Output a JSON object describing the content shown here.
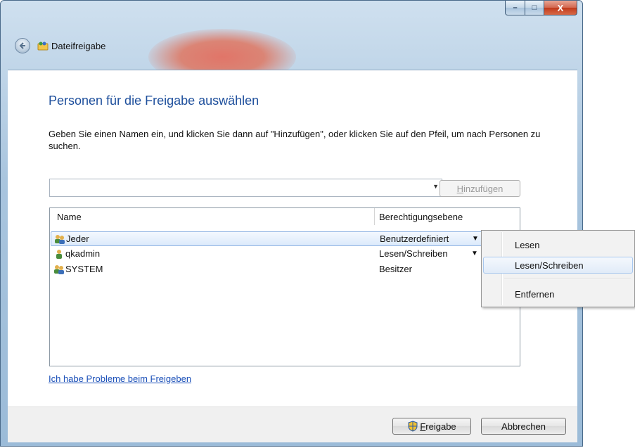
{
  "window": {
    "title": "Dateifreigabe",
    "controls": {
      "minimize": "–",
      "maximize": "□",
      "close": "X"
    }
  },
  "page": {
    "heading": "Personen für die Freigabe auswählen",
    "instruction": "Geben Sie einen Namen ein, und klicken Sie dann auf \"Hinzufügen\", oder klicken Sie auf den Pfeil, um nach Personen zu suchen.",
    "name_input": {
      "value": "",
      "placeholder": ""
    },
    "add_button": {
      "prefix": "",
      "accel": "H",
      "rest": "inzufügen",
      "enabled": false
    },
    "help_link": "Ich habe Probleme beim Freigeben"
  },
  "list": {
    "columns": {
      "name": "Name",
      "permission": "Berechtigungsebene"
    },
    "rows": [
      {
        "name": "Jeder",
        "permission": "Benutzerdefiniert",
        "has_dropdown": true,
        "selected": true,
        "icon": "group-icon"
      },
      {
        "name": "qkadmin",
        "permission": "Lesen/Schreiben",
        "has_dropdown": true,
        "selected": false,
        "icon": "user-icon"
      },
      {
        "name": "SYSTEM",
        "permission": "Besitzer",
        "has_dropdown": false,
        "selected": false,
        "icon": "group-icon"
      }
    ]
  },
  "context_menu": {
    "items": [
      "Lesen",
      "Lesen/Schreiben",
      "Entfernen"
    ],
    "highlighted": "Lesen/Schreiben"
  },
  "footer": {
    "share_button": {
      "accel": "F",
      "rest": "reigabe"
    },
    "cancel_button": "Abbrechen"
  },
  "colors": {
    "heading": "#1e4f9c",
    "link": "#1a4fb8",
    "selection": "#dceafb"
  }
}
